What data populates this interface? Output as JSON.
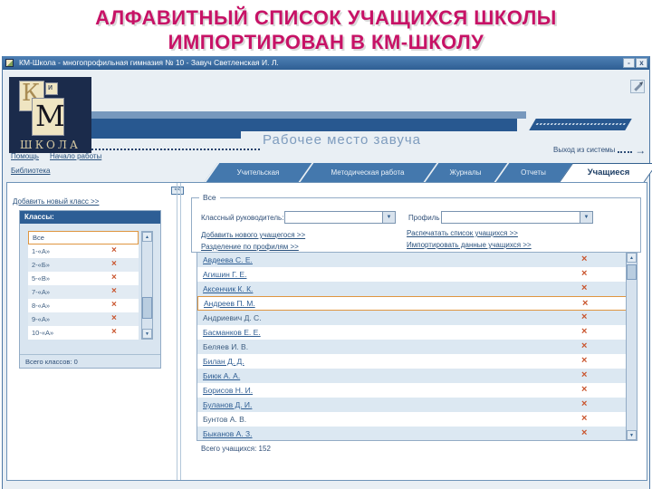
{
  "slide": {
    "title_line1": "АЛФАВИТНЫЙ СПИСОК УЧАЩИХСЯ ШКОЛЫ",
    "title_line2": "ИМПОРТИРОВАН В КМ-ШКОЛУ"
  },
  "window": {
    "title": "КМ-Школа - многопрофильная гимназия № 10 - Завуч Светленская И. Л.",
    "minimize": "-",
    "close": "x"
  },
  "header": {
    "logo_k": "К",
    "logo_i": "и",
    "logo_m": "М",
    "logo_school": "ШКОЛА",
    "workplace": "Рабочее место завуча",
    "logout": "Выход из системы"
  },
  "nav": {
    "help": "Помощь",
    "start": "Начало работы",
    "library": "Библиотека"
  },
  "tabs": [
    {
      "label": "Учительская"
    },
    {
      "label": "Методическая работа"
    },
    {
      "label": "Журналы"
    },
    {
      "label": "Отчеты"
    },
    {
      "label": "Учащиеся"
    }
  ],
  "classes_panel": {
    "add_link": "Добавить новый класс >>",
    "header": "Классы:",
    "all_label": "Все",
    "items": [
      "1-«А»",
      "2-«Б»",
      "5-«В»",
      "7-«А»",
      "8-«А»",
      "9-«А»",
      "10-«А»"
    ],
    "total": "Всего классов: 0",
    "collapse": "<<"
  },
  "filters": {
    "legend": "Все",
    "teacher_label": "Классный руководитель:",
    "teacher_value": "",
    "profile_label": "Профиль :",
    "profile_value": "",
    "add_student_link": "Добавить нового учащегося >>",
    "split_profiles_link": "Разделение по профилям >>",
    "print_list_link": "Распечатать список учащихся >>",
    "import_data_link": "Импортировать данные учащихся >>"
  },
  "students": {
    "rows": [
      {
        "name": "Авдеева С. Е."
      },
      {
        "name": "Агишин Г. Е."
      },
      {
        "name": "Аксенчик К. К."
      },
      {
        "name": "Андреев П. М."
      },
      {
        "name": "Андриевич Д. С."
      },
      {
        "name": "Басманков Е. Е."
      },
      {
        "name": "Беляев И. В."
      },
      {
        "name": "Билан Д. Д."
      },
      {
        "name": "Биюк А. А."
      },
      {
        "name": "Борисов Н. И."
      },
      {
        "name": "Буланов Д. И."
      },
      {
        "name": "Бунтов А. В."
      },
      {
        "name": "Быканов А. З."
      }
    ],
    "total": "Всего учащихся: 152"
  },
  "icons": {
    "delete": "×",
    "dropdown": "▼",
    "scroll_up": "▲",
    "scroll_down": "▼",
    "arrow_right": "→"
  },
  "colors": {
    "slide_title": "#C71266",
    "band": "#285890",
    "tab": "#4478AD",
    "selection_border": "#DF9640",
    "delete_x": "#C9552E"
  }
}
